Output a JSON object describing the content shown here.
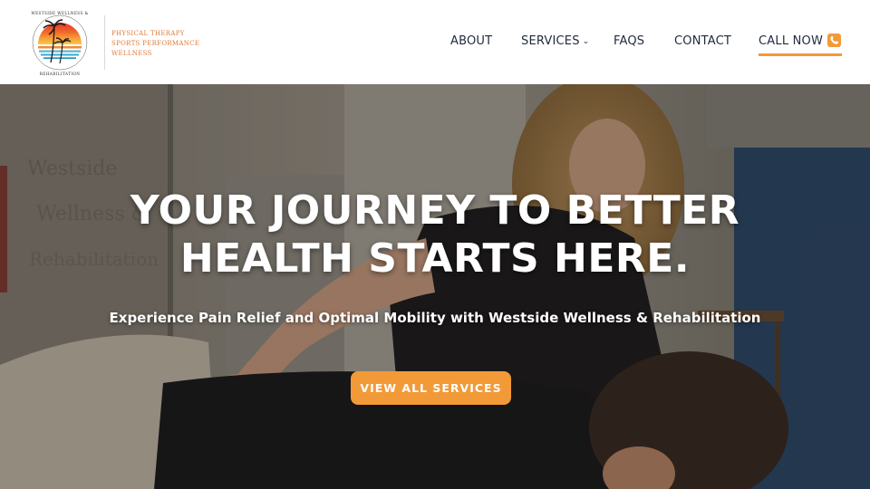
{
  "brand": {
    "logo_text": "WESTSIDE WELLNESS & REHABILITATION",
    "tagline": [
      "PHYSICAL THERAPY",
      "SPORTS PERFORMANCE",
      "WELLNESS"
    ]
  },
  "nav": {
    "items": [
      {
        "label": "ABOUT"
      },
      {
        "label": "SERVICES",
        "has_dropdown": true
      },
      {
        "label": "FAQS"
      },
      {
        "label": "CONTACT"
      }
    ],
    "call_now_label": "CALL NOW",
    "call_icon": "phone-icon"
  },
  "hero": {
    "title_line1": "YOUR JOURNEY TO BETTER",
    "title_line2": "HEALTH STARTS HERE.",
    "subtitle": "Experience Pain Relief and Optimal Mobility with Westside Wellness & Rehabilitation",
    "button_label": "VIEW ALL SERVICES"
  },
  "colors": {
    "accent": "#f29a38",
    "nav_text": "#1f2a3c",
    "tagline": "#e07a3a"
  }
}
